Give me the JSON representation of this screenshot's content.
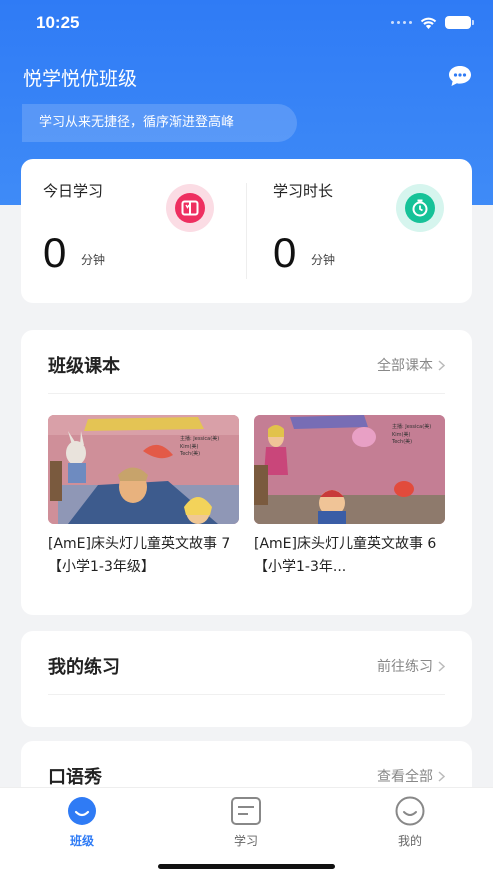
{
  "status": {
    "time": "10:25"
  },
  "header": {
    "title": "悦学悦优班级",
    "motto": "学习从来无捷径，循序渐进登高峰"
  },
  "stats": {
    "today": {
      "label": "今日学习",
      "value": "0",
      "unit": "分钟",
      "icon": "book-icon",
      "color": "#ee2f60"
    },
    "duration": {
      "label": "学习时长",
      "value": "0",
      "unit": "分钟",
      "icon": "timer-icon",
      "color": "#16c298"
    }
  },
  "courses": {
    "title": "班级课本",
    "link": "全部课本",
    "items": [
      {
        "name": "[AmE]床头灯儿童英文故事 7【小学1-3年级】"
      },
      {
        "name": "[AmE]床头灯儿童英文故事 6【小学1-3年..."
      }
    ]
  },
  "practice": {
    "title": "我的练习",
    "link": "前往练习"
  },
  "oral": {
    "title": "口语秀",
    "link": "查看全部"
  },
  "tabs": [
    {
      "label": "班级",
      "icon": "smile-icon",
      "active": true
    },
    {
      "label": "学习",
      "icon": "notebook-icon",
      "active": false
    },
    {
      "label": "我的",
      "icon": "user-smile-icon",
      "active": false
    }
  ],
  "colors": {
    "brand": "#2f7bf5",
    "background": "#f2f3f5"
  }
}
